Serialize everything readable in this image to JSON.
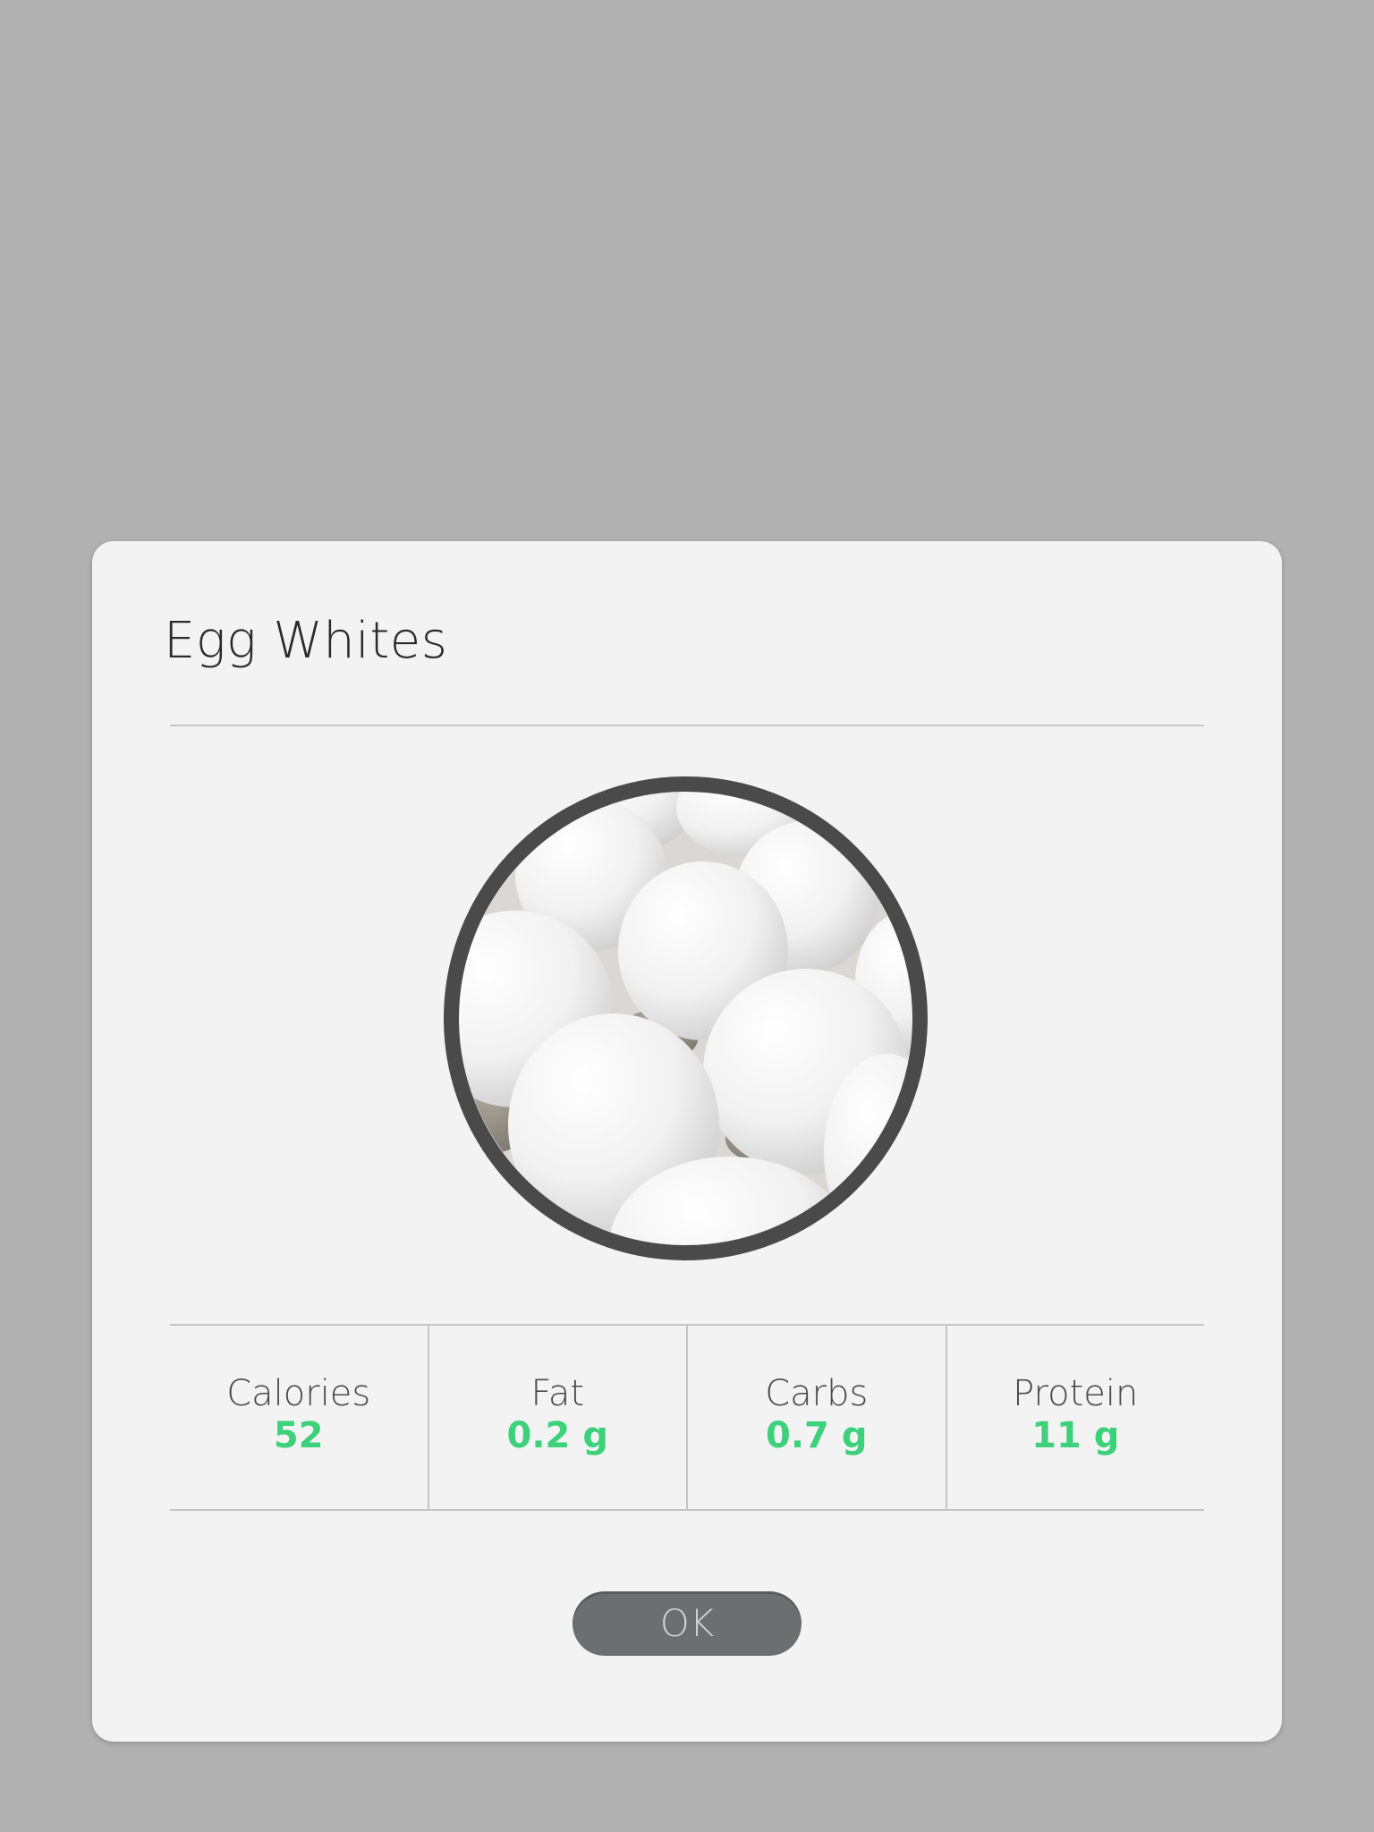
{
  "dialog": {
    "title": "Egg Whites",
    "image_alt": "egg-whites-food-image",
    "stats": [
      {
        "label": "Calories",
        "value": "52"
      },
      {
        "label": "Fat",
        "value": "0.2 g"
      },
      {
        "label": "Carbs",
        "value": "0.7 g"
      },
      {
        "label": "Protein",
        "value": "11 g"
      }
    ],
    "ok_label": "OK"
  },
  "colors": {
    "backdrop": "#b1b1b1",
    "dialog_background": "#f2f3f2",
    "accent_value": "#3dd17c",
    "button_background": "#6d6e70",
    "image_ring": "#4a4a4a"
  }
}
